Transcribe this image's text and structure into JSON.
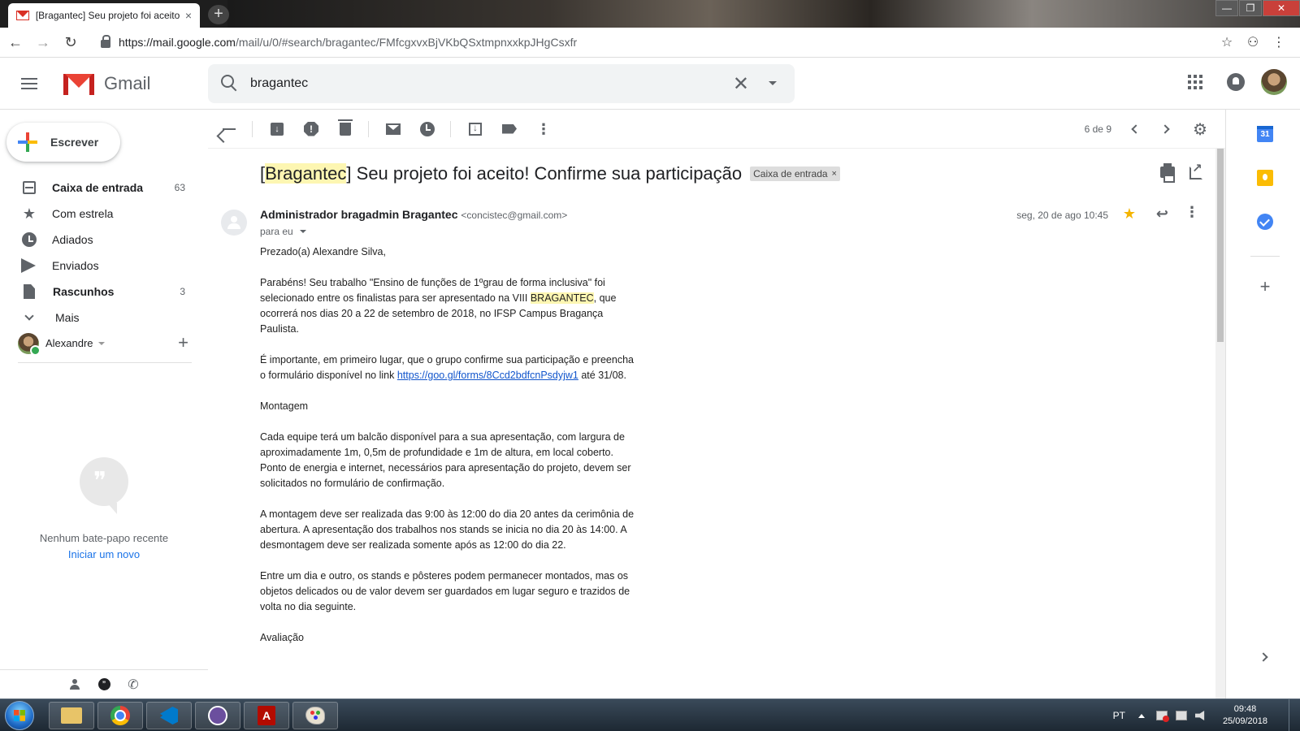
{
  "browser": {
    "tab_title": "[Bragantec] Seu projeto foi aceito! Confirme sua participação",
    "tab_close": "×",
    "new_tab": "+",
    "url_host": "https://mail.google.com",
    "url_path": "/mail/u/0/#search/bragantec/FMfcgxvxBjVKbQSxtmpnxxkpJHgCsxfr",
    "window_controls": {
      "minimize": "—",
      "maximize": "❐",
      "close": "✕"
    }
  },
  "header": {
    "app_name": "Gmail",
    "search_value": "bragantec",
    "clear_label": "✕"
  },
  "sidebar": {
    "compose_label": "Escrever",
    "items": [
      {
        "label": "Caixa de entrada",
        "count": "63",
        "icon": "inbox-icon",
        "bold": true
      },
      {
        "label": "Com estrela",
        "count": "",
        "icon": "star-icon",
        "bold": false
      },
      {
        "label": "Adiados",
        "count": "",
        "icon": "clock-icon",
        "bold": false
      },
      {
        "label": "Enviados",
        "count": "",
        "icon": "send-icon",
        "bold": false
      },
      {
        "label": "Rascunhos",
        "count": "3",
        "icon": "draft-icon",
        "bold": true
      },
      {
        "label": "Mais",
        "count": "",
        "icon": "chevron-down-icon",
        "bold": false
      }
    ],
    "hangouts_user": "Alexandre",
    "hangouts_add": "+",
    "chat_empty_text": "Nenhum bate-papo recente",
    "chat_start_link": "Iniciar um novo",
    "chat_quote_glyph": "❞",
    "phone_glyph": "✆"
  },
  "toolbar": {
    "pager": "6 de 9",
    "more_glyph": "⋮",
    "settings_glyph": "⚙",
    "spam_glyph": "!"
  },
  "message": {
    "subject_prefix": "[",
    "subject_highlight": "Bragantec",
    "subject_rest": "] Seu projeto foi aceito! Confirme sua participação",
    "label": "Caixa de entrada",
    "label_remove": "×",
    "sender_name": "Administrador bragadmin Bragantec",
    "sender_email": "<concistec@gmail.com>",
    "to": "para eu",
    "date": "seg, 20 de ago 10:45",
    "star_glyph": "★",
    "reply_glyph": "↩",
    "more_glyph": "⋮",
    "greeting": "Prezado(a) Alexandre Silva,",
    "p1_a": "Parabéns! Seu trabalho \"Ensino de funções de 1ºgrau de forma inclusiva\" foi selecionado entre os finalistas para ser apresentado na VIII ",
    "p1_highlight": "BRAGANTEC",
    "p1_b": ", que ocorrerá nos dias 20 a 22 de setembro de 2018, no IFSP Campus Bragança Paulista.",
    "p2_a": "É importante, em primeiro lugar, que o grupo confirme sua participação e preencha o formulário disponível no link ",
    "p2_link": "https://goo.gl/forms/8Ccd2bdfcnPsdyjw1",
    "p2_b": " até 31/08.",
    "h_montagem": "Montagem",
    "p3": "Cada equipe terá um balcão disponível para a sua apresentação, com largura de aproximadamente 1m, 0,5m de profundidade e 1m de altura, em local coberto. Ponto de energia e internet, necessários para apresentação do projeto, devem ser solicitados no formulário de confirmação.",
    "p4": "A montagem deve ser realizada das 9:00 às 12:00 do dia 20 antes da cerimônia de abertura. A apresentação dos trabalhos nos stands se inicia no dia 20 às 14:00. A desmontagem deve ser realizada somente após as 12:00 do dia 22.",
    "p5": "Entre um dia e outro, os stands e pôsteres podem permanecer montados, mas os objetos delicados ou de valor devem ser guardados em lugar seguro e trazidos de volta no dia seguinte.",
    "h_avaliacao": "Avaliação"
  },
  "addons": {
    "calendar_day": "31",
    "add": "+"
  },
  "taskbar": {
    "lang": "PT",
    "time": "09:48",
    "date": "25/09/2018",
    "pdf_glyph": "A"
  }
}
